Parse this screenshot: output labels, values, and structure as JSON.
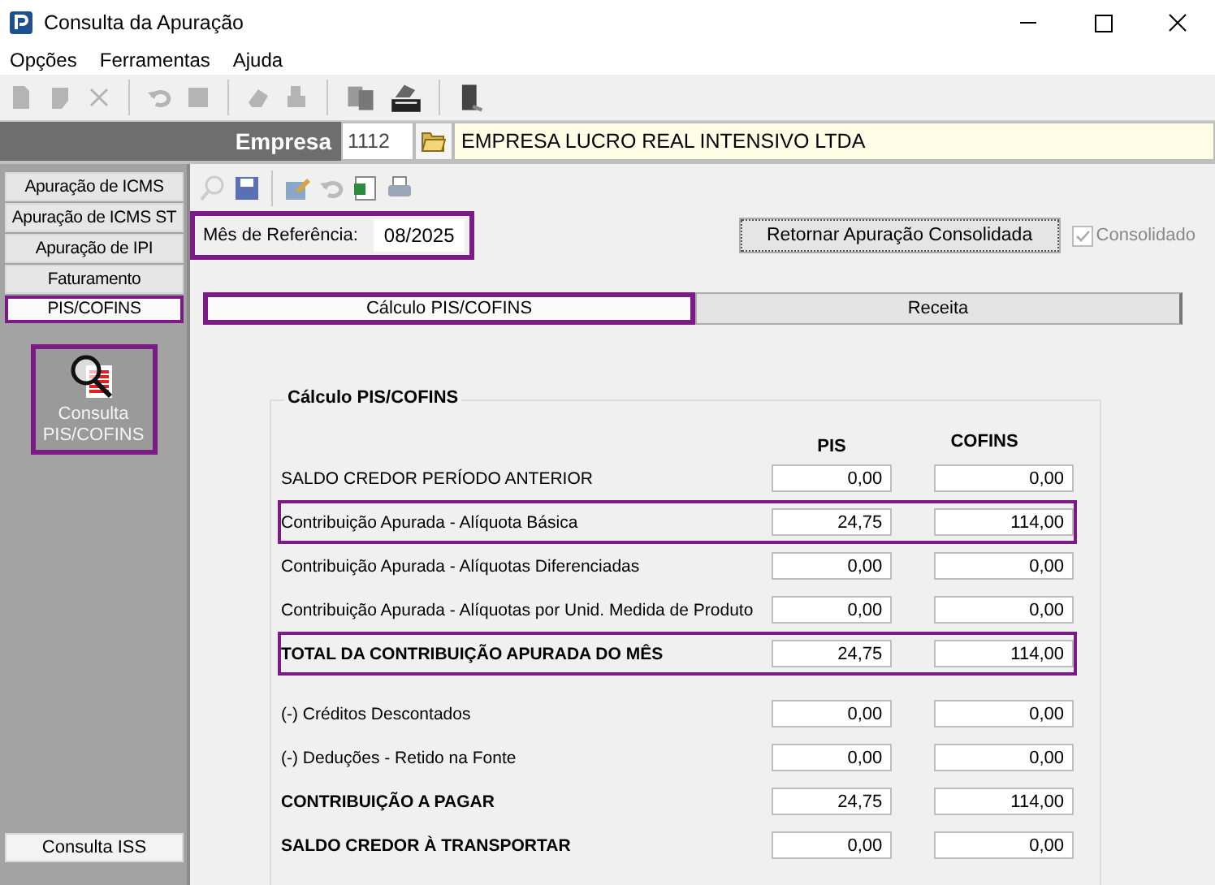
{
  "window": {
    "title": "Consulta da Apuração"
  },
  "menu": [
    "Opções",
    "Ferramentas",
    "Ajuda"
  ],
  "company": {
    "label": "Empresa",
    "code": "1112",
    "name": "EMPRESA LUCRO REAL INTENSIVO LTDA"
  },
  "sidebar": {
    "items": [
      {
        "label": "Apuração de ICMS",
        "selected": false,
        "highlighted": false
      },
      {
        "label": "Apuração de ICMS ST",
        "selected": false,
        "highlighted": false
      },
      {
        "label": "Apuração de IPI",
        "selected": false,
        "highlighted": false
      },
      {
        "label": "Faturamento",
        "selected": false,
        "highlighted": false
      },
      {
        "label": "PIS/COFINS",
        "selected": true,
        "highlighted": true
      }
    ],
    "tile": {
      "lines": [
        "Consulta",
        "PIS/COFINS"
      ],
      "highlighted": true
    },
    "bottom_item": {
      "label": "Consulta ISS"
    }
  },
  "reference": {
    "label": "Mês de Referência:",
    "value": "08/2025",
    "highlighted": true
  },
  "consolidate_button": {
    "label": "Retornar Apuração Consolidada"
  },
  "consolidated": {
    "label": "Consolidado",
    "checked": true,
    "disabled": true
  },
  "tabs": [
    {
      "label": "Cálculo PIS/COFINS",
      "selected": true,
      "highlighted": true
    },
    {
      "label": "Receita",
      "selected": false,
      "highlighted": false
    }
  ],
  "group": {
    "title": "Cálculo PIS/COFINS",
    "columns": [
      "PIS",
      "COFINS"
    ],
    "sections": [
      [
        {
          "label": "SALDO CREDOR PERÍODO ANTERIOR",
          "kind": "normal",
          "highlighted": false,
          "pis": "0,00",
          "cofins": "0,00"
        },
        {
          "label": "Contribuição Apurada - Alíquota Básica",
          "kind": "normal",
          "highlighted": true,
          "pis": "24,75",
          "cofins": "114,00"
        },
        {
          "label": "Contribuição Apurada - Alíquotas Diferenciadas",
          "kind": "normal",
          "highlighted": false,
          "pis": "0,00",
          "cofins": "0,00"
        },
        {
          "label": "Contribuição Apurada - Alíquotas por Unid. Medida de Produto",
          "kind": "normal",
          "highlighted": false,
          "pis": "0,00",
          "cofins": "0,00"
        },
        {
          "label": "TOTAL DA CONTRIBUIÇÃO APURADA DO MÊS",
          "kind": "total",
          "highlighted": true,
          "pis": "24,75",
          "cofins": "114,00"
        }
      ],
      [
        {
          "label": "(-) Créditos Descontados",
          "kind": "normal",
          "highlighted": false,
          "pis": "0,00",
          "cofins": "0,00"
        },
        {
          "label": "(-) Deduções - Retido na Fonte",
          "kind": "normal",
          "highlighted": false,
          "pis": "0,00",
          "cofins": "0,00"
        },
        {
          "label": "CONTRIBUIÇÃO A PAGAR",
          "kind": "total",
          "highlighted": false,
          "pis": "24,75",
          "cofins": "114,00"
        },
        {
          "label": "SALDO CREDOR À TRANSPORTAR",
          "kind": "total",
          "highlighted": false,
          "pis": "0,00",
          "cofins": "0,00"
        }
      ]
    ]
  }
}
